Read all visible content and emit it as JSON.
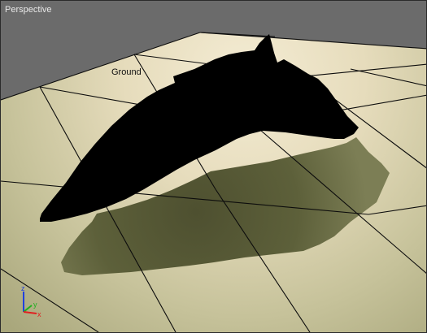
{
  "viewport": {
    "label": "Perspective",
    "object_label": "Ground"
  },
  "axis_gizmo": {
    "z": "z",
    "y": "y",
    "x": "x"
  },
  "colors": {
    "background": "#6b6b6b",
    "ground_light": "#efe6cc",
    "ground_dark": "#7b7d52",
    "grid_lines": "#0c0c0c",
    "object": "#000000",
    "axis_x": "#e02020",
    "axis_y": "#20b020",
    "axis_z": "#2040e0"
  }
}
